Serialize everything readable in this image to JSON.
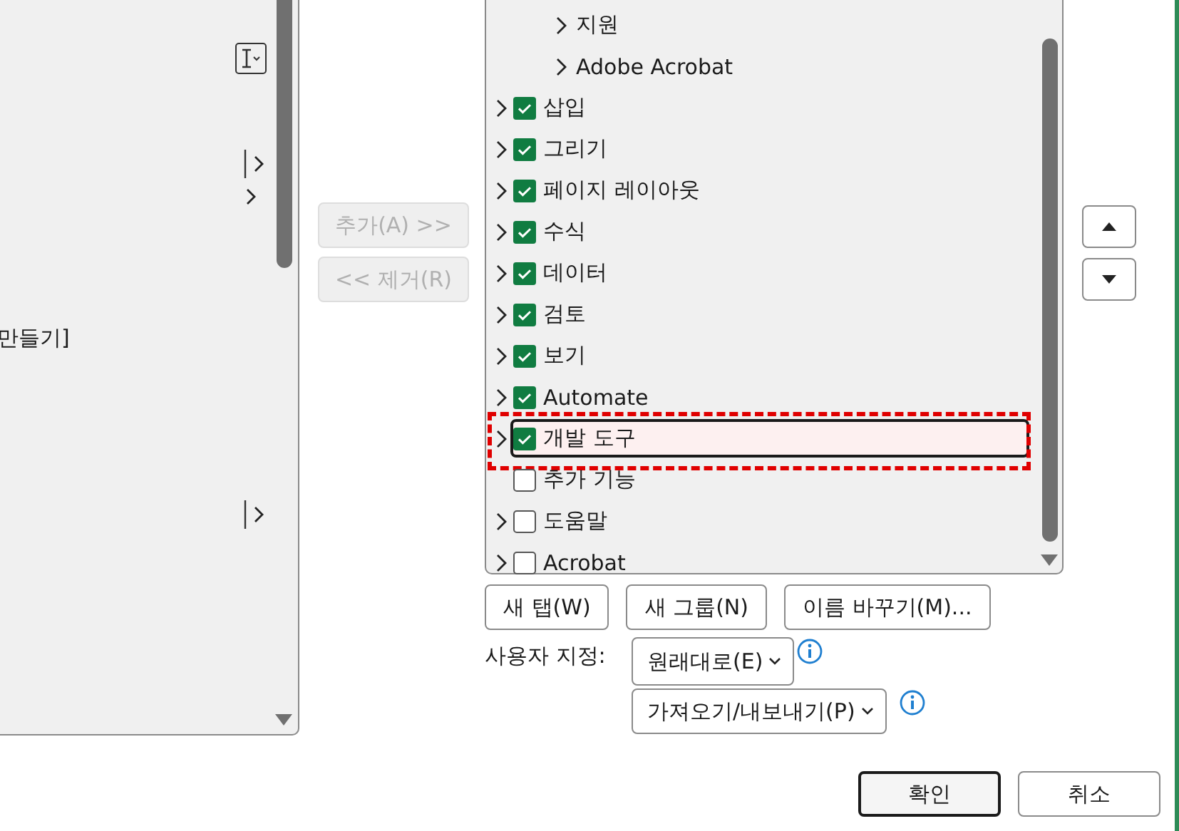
{
  "left_list": {
    "partial_item": "만들기]"
  },
  "transfer_buttons": [
    {
      "label": "추가(A) >>",
      "disabled": true
    },
    {
      "label": "<< 제거(R)",
      "disabled": true
    }
  ],
  "tabs_tree": {
    "items": [
      {
        "children": [
          {
            "label": "지원",
            "expandable": true
          },
          {
            "label": "Adobe Acrobat",
            "expandable": true
          }
        ]
      },
      {
        "label": "삽입",
        "checked": true,
        "expandable": true,
        "selected": false,
        "annotated": false
      },
      {
        "label": "그리기",
        "checked": true,
        "expandable": true,
        "selected": false,
        "annotated": false
      },
      {
        "label": "페이지 레이아웃",
        "checked": true,
        "expandable": true,
        "selected": false,
        "annotated": false
      },
      {
        "label": "수식",
        "checked": true,
        "expandable": true,
        "selected": false,
        "annotated": false
      },
      {
        "label": "데이터",
        "checked": true,
        "expandable": true,
        "selected": false,
        "annotated": false
      },
      {
        "label": "검토",
        "checked": true,
        "expandable": true,
        "selected": false,
        "annotated": false
      },
      {
        "label": "보기",
        "checked": true,
        "expandable": true,
        "selected": false,
        "annotated": false
      },
      {
        "label": "Automate",
        "checked": true,
        "expandable": true,
        "selected": false,
        "annotated": false
      },
      {
        "label": "개발 도구",
        "checked": true,
        "expandable": true,
        "selected": true,
        "annotated": true
      },
      {
        "label": "추가 기능",
        "checked": false,
        "expandable": false,
        "selected": false,
        "annotated": false
      },
      {
        "label": "도움말",
        "checked": false,
        "expandable": true,
        "selected": false,
        "annotated": false
      },
      {
        "label": "Acrobat",
        "checked": false,
        "expandable": true,
        "selected": false,
        "annotated": false
      }
    ]
  },
  "tree_buttons": [
    {
      "label": "새 탭(W)"
    },
    {
      "label": "새 그룹(N)"
    },
    {
      "label": "이름 바꾸기(M)..."
    }
  ],
  "customize": {
    "label": "사용자 지정:",
    "dropdowns": [
      {
        "label": "원래대로(E)"
      },
      {
        "label": "가져오기/내보내기(P)"
      }
    ]
  },
  "dialog_buttons": [
    {
      "label": "확인",
      "default": true
    },
    {
      "label": "취소",
      "default": false
    }
  ]
}
